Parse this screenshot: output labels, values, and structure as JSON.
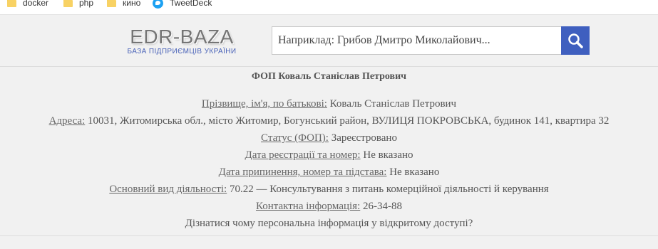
{
  "bookmarks": [
    {
      "label": "docker",
      "icon": "folder-icon"
    },
    {
      "label": "php",
      "icon": "folder-icon"
    },
    {
      "label": "кино",
      "icon": "folder-icon"
    },
    {
      "label": "TweetDeck",
      "icon": "twitter-icon"
    }
  ],
  "logo": {
    "title": "EDR-BAZA",
    "subtitle": "БАЗА ПІДПРИЄМЦІВ УКРАЇНИ"
  },
  "search": {
    "placeholder": "Наприклад: Грибов Дмитро Миколайович...",
    "button_icon": "search-icon",
    "button_color": "#3f5fbf"
  },
  "entity": {
    "title": "ФОП Коваль Станіслав Петрович",
    "rows": [
      {
        "label": "Прізвище, ім'я, по батькові:",
        "value": "Коваль Станіслав Петрович"
      },
      {
        "label": "Адреса:",
        "value": "10031, Житомирська обл., місто Житомир, Богунський район, ВУЛИЦЯ ПОКРОВСЬКА, будинок 141, квартира 32"
      },
      {
        "label": "Статус (ФОП):",
        "value": "Зареєстровано"
      },
      {
        "label": "Дата реєстрації та номер:",
        "value": "Не вказано"
      },
      {
        "label": "Дата припинення, номер та підстава:",
        "value": "Не вказано"
      },
      {
        "label": "Основний вид діяльності:",
        "value": "70.22 — Консультування з питань комерційної діяльності й керування"
      },
      {
        "label": "Контактна інформація:",
        "value": "26-34-88"
      }
    ],
    "privacy_link": "Дізнатися чому персональна інформація у відкритому доступі?"
  }
}
